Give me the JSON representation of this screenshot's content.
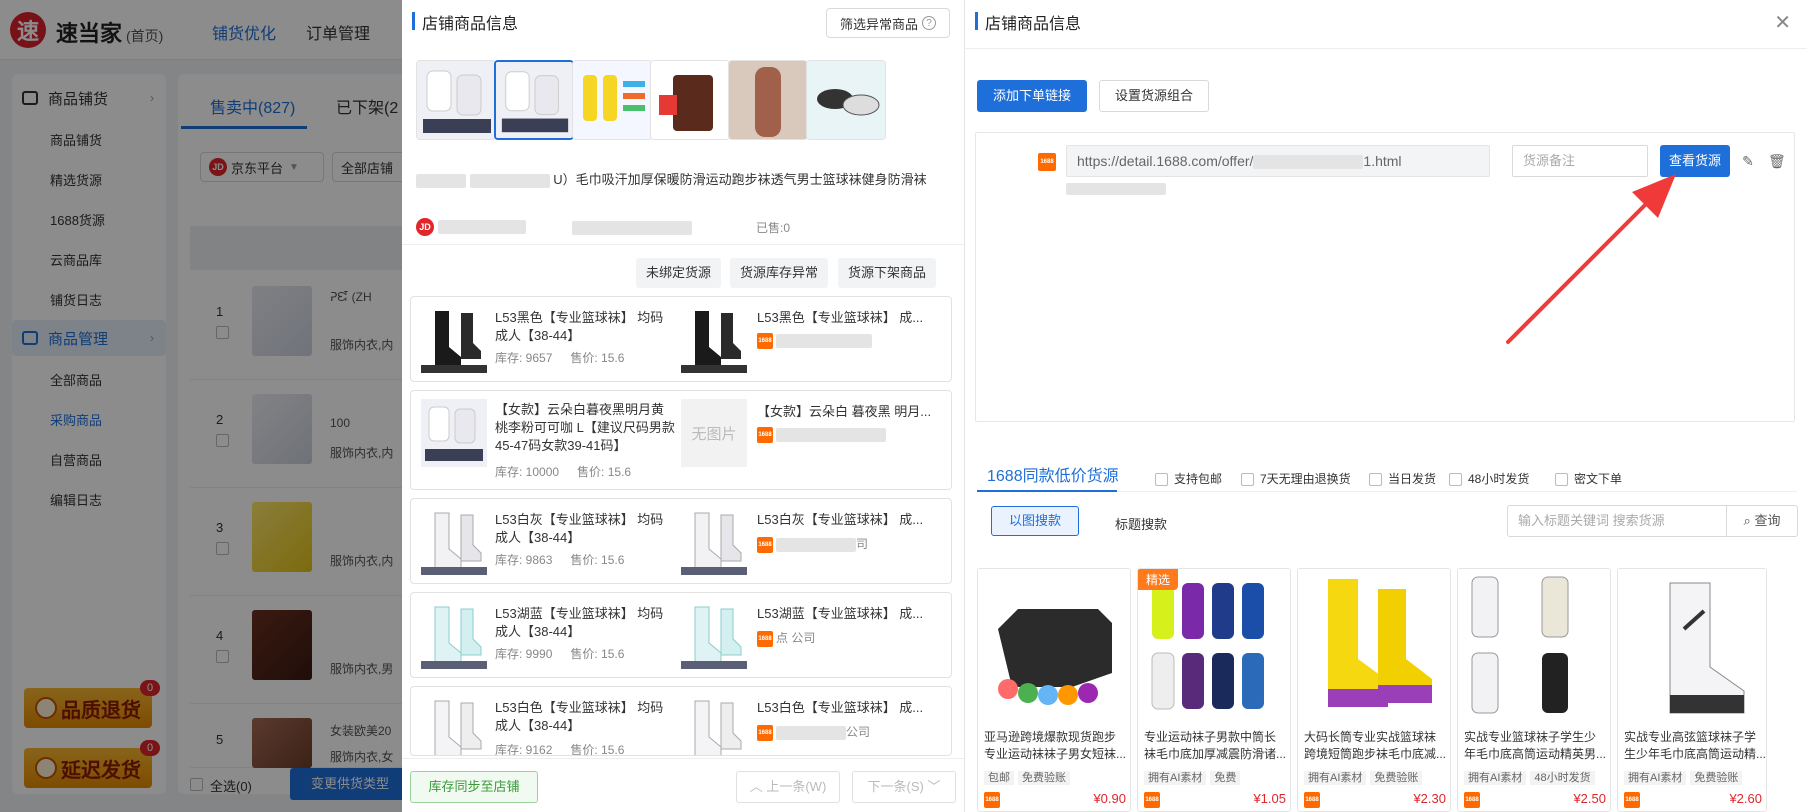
{
  "app": {
    "logo_char": "速",
    "name": "速当家",
    "home": "(首页)"
  },
  "topnav": [
    "铺货优化",
    "订单管理"
  ],
  "sidebar": {
    "groups": [
      {
        "label": "商品铺货",
        "items": [
          "商品铺货",
          "精选货源",
          "1688货源",
          "云商品库",
          "铺货日志"
        ]
      },
      {
        "label": "商品管理",
        "items": [
          "全部商品",
          "采购商品",
          "自营商品",
          "编辑日志"
        ]
      }
    ],
    "promos": [
      {
        "label": "品质退货",
        "badge": "0"
      },
      {
        "label": "延迟发货",
        "badge": "0"
      }
    ]
  },
  "bg": {
    "tabs": [
      "售卖中(827)",
      "已下架(2"
    ],
    "platform": "京东平台",
    "shop": "全部店铺",
    "rows": [
      {
        "num": "1",
        "line1": "ᕈᘿ (ZH",
        "line2": "服饰内衣,内"
      },
      {
        "num": "2",
        "line1": "100",
        "line2": "服饰内衣,内"
      },
      {
        "num": "3",
        "line1": "",
        "line2": "服饰内衣,内"
      },
      {
        "num": "4",
        "line1": "",
        "line2": "服饰内衣,男"
      },
      {
        "num": "5",
        "line1": "女装欧美20",
        "line2": "服饰内衣,女"
      }
    ],
    "select_all": "全选(0)",
    "change_supply": "变更供货类型"
  },
  "mid": {
    "title": "店铺商品信息",
    "filter_abnormal": "筛选异常商品",
    "product_title": "U）毛巾吸汗加厚保暖防滑运动跑步袜透气男士篮球袜健身防滑袜",
    "sold": "已售:0",
    "filters": [
      "未绑定货源",
      "货源库存异常",
      "货源下架商品"
    ],
    "skus": [
      {
        "name": "L53黑色【专业篮球袜】 均码成人【38-44】",
        "stock": "库存: 9657",
        "price": "售价: 15.6",
        "src_name": "L53黑色【专业篮球袜】 成...",
        "src_shop": ""
      },
      {
        "name": "【女款】云朵白暮夜黑明月黄桃李粉可可咖 L【建议尺码男款45-47码女款39-41码】",
        "stock": "库存: 10000",
        "price": "售价: 15.6",
        "src_name": "【女款】云朵白 暮夜黑 明月...",
        "src_shop": "",
        "noimg": "无图片"
      },
      {
        "name": "L53白灰【专业篮球袜】 均码成人【38-44】",
        "stock": "库存: 9863",
        "price": "售价: 15.6",
        "src_name": "L53白灰【专业篮球袜】 成...",
        "src_shop": "司"
      },
      {
        "name": "L53湖蓝【专业篮球袜】 均码成人【38-44】",
        "stock": "库存: 9990",
        "price": "售价: 15.6",
        "src_name": "L53湖蓝【专业篮球袜】 成...",
        "src_shop": "点 公司"
      },
      {
        "name": "L53白色【专业篮球袜】 均码成人【38-44】",
        "stock": "库存: 9162",
        "price": "售价: 15.6",
        "src_name": "L53白色【专业篮球袜】 成...",
        "src_shop": "公司"
      }
    ],
    "sync_btn": "库存同步至店铺",
    "prev_btn": "上一条(W)",
    "next_btn": "下一条(S)"
  },
  "right": {
    "title": "店铺商品信息",
    "add_link": "添加下单链接",
    "set_combo": "设置货源组合",
    "url_prefix": "https://detail.1688.com/offer/",
    "url_suffix": "1.html",
    "note_placeholder": "货源备注",
    "view_source": "查看货源",
    "tab_label": "1688同款低价货源",
    "options": [
      "支持包邮",
      "7天无理由退换货",
      "当日发货",
      "48小时发货",
      "密文下单"
    ],
    "search_modes": [
      "以图搜款",
      "标题搜款"
    ],
    "search_placeholder": "输入标题关键词  搜索货源",
    "search_btn": "查询",
    "products": [
      {
        "title": "亚马逊跨境爆款现货跑步专业运动袜袜子男女短袜...",
        "tags": [
          "包邮",
          "免费验账"
        ],
        "price": "¥0.90",
        "badge": ""
      },
      {
        "title": "专业运动袜子男款中筒长袜毛巾底加厚减震防滑诸...",
        "tags": [
          "拥有AI素材",
          "免费"
        ],
        "price": "¥1.05",
        "badge": "精选"
      },
      {
        "title": "大码长筒专业实战篮球袜跨境短筒跑步袜毛巾底减...",
        "tags": [
          "拥有AI素材",
          "免费验账"
        ],
        "price": "¥2.30",
        "badge": ""
      },
      {
        "title": "实战专业篮球袜子学生少年毛巾底高筒运动精英男...",
        "tags": [
          "拥有AI素材",
          "48小时发货"
        ],
        "price": "¥2.50",
        "badge": ""
      },
      {
        "title": "实战专业高弦篮球袜子学生少年毛巾底高筒运动精...",
        "tags": [
          "拥有AI素材",
          "免费验账"
        ],
        "price": "¥2.60",
        "badge": ""
      }
    ]
  },
  "colors": {
    "accent": "#1e6fd9",
    "price": "#e0262b",
    "brand1688": "#ff6a00",
    "jd": "#e0262b"
  }
}
